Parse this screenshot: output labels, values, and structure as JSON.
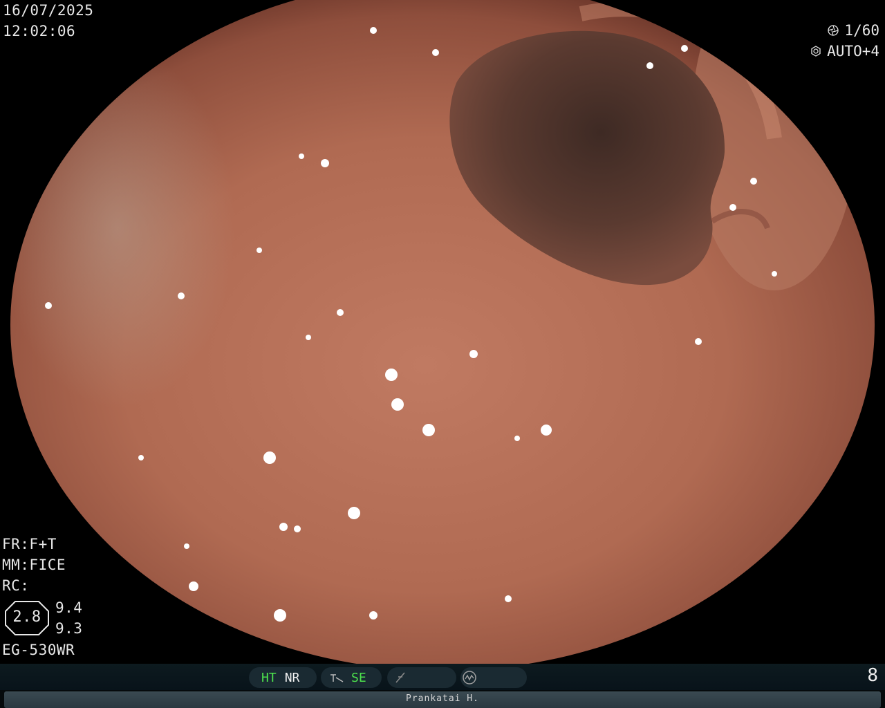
{
  "overlay": {
    "date": "16/07/2025",
    "time": "12:02:06",
    "shutter": "1/60",
    "iris": "AUTO+4",
    "fr": "FR:F+T",
    "mm": "MM:FICE",
    "rc": "RC:",
    "zoom": "2.8",
    "value1": "9.4",
    "value2": "9.3",
    "scope_model": "EG-530WR"
  },
  "status_bar": {
    "ht": "HT",
    "nr": "NR",
    "se": "SE",
    "page": "8",
    "operator": "Prankatai H.",
    "colors": {
      "active": "#4de34d",
      "inactive": "#f0f0f0"
    }
  },
  "icons": [
    "shutter-icon",
    "iris-icon",
    "enhance-icon",
    "freeze-icon",
    "waveform-icon"
  ]
}
